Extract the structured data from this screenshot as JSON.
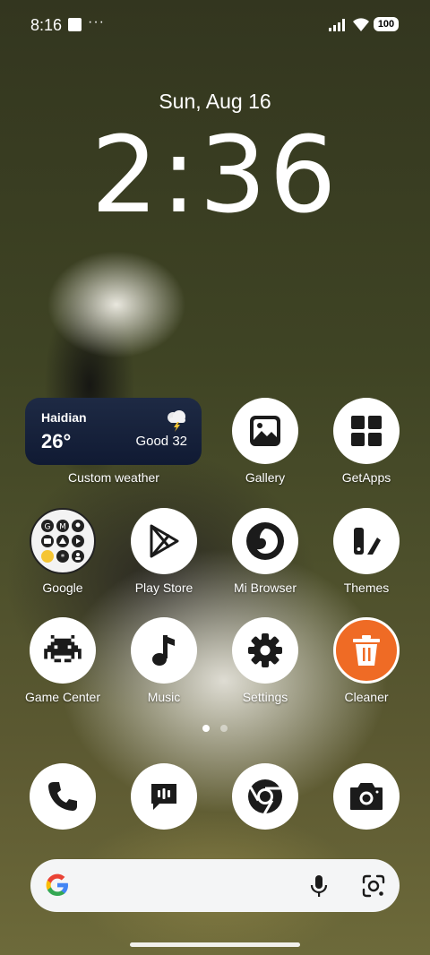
{
  "status_bar": {
    "time": "8:16",
    "dots": "···",
    "battery": "100"
  },
  "lock": {
    "date": "Sun, Aug 16",
    "time": "2:36"
  },
  "weather": {
    "city": "Haidian",
    "temp": "26°",
    "aqi": "Good 32",
    "label": "Custom weather",
    "icon": "thunderstorm-icon"
  },
  "apps": [
    {
      "label": "Gallery",
      "icon": "gallery-icon"
    },
    {
      "label": "GetApps",
      "icon": "getapps-icon"
    },
    {
      "label": "Google",
      "icon": "google-folder-icon"
    },
    {
      "label": "Play Store",
      "icon": "play-store-icon"
    },
    {
      "label": "Mi Browser",
      "icon": "mi-browser-icon"
    },
    {
      "label": "Themes",
      "icon": "themes-icon"
    },
    {
      "label": "Game Center",
      "icon": "game-center-icon"
    },
    {
      "label": "Music",
      "icon": "music-icon"
    },
    {
      "label": "Settings",
      "icon": "settings-icon"
    },
    {
      "label": "Cleaner",
      "icon": "cleaner-icon"
    }
  ],
  "dock": [
    "phone-icon",
    "messages-icon",
    "chrome-icon",
    "camera-icon"
  ],
  "pages": {
    "count": 2,
    "active": 1
  },
  "search": {
    "icons": [
      "google-g-icon",
      "microphone-icon",
      "google-lens-icon"
    ]
  },
  "colors": {
    "cleaner_accent": "#ef6b25",
    "widget_bg": "#141e38",
    "icon_fg": "#1b1b1b"
  }
}
